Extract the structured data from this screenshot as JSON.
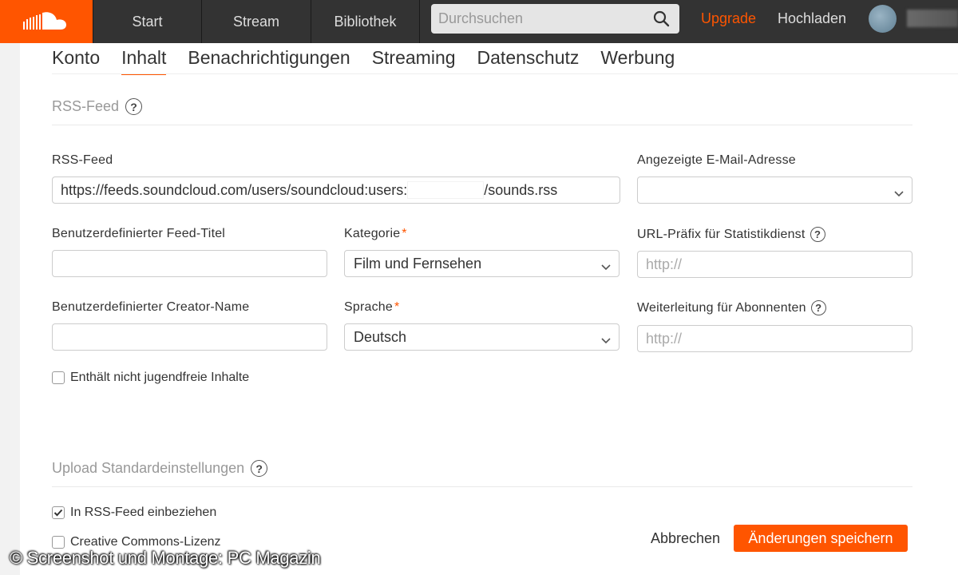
{
  "topbar": {
    "nav": [
      "Start",
      "Stream",
      "Bibliothek"
    ],
    "search_placeholder": "Durchsuchen",
    "upgrade": "Upgrade",
    "upload": "Hochladen",
    "accent": "#ff5500"
  },
  "tabs": [
    "Konto",
    "Inhalt",
    "Benachrichtigungen",
    "Streaming",
    "Datenschutz",
    "Werbung"
  ],
  "active_tab": "Inhalt",
  "rss_section": {
    "title": "RSS-Feed",
    "rss_feed_label": "RSS-Feed",
    "rss_feed_prefix": "https://feeds.soundcloud.com/users/soundcloud:users:",
    "rss_feed_suffix": "/sounds.rss",
    "email_label": "Angezeigte E-Mail-Adresse",
    "feed_title_label": "Benutzerdefinierter Feed-Titel",
    "category_label": "Kategorie",
    "category_value": "Film und Fernsehen",
    "url_prefix_label": "URL-Präfix für Statistikdienst",
    "url_prefix_placeholder": "http://",
    "creator_label": "Benutzerdefinierter Creator-Name",
    "language_label": "Sprache",
    "language_value": "Deutsch",
    "redirect_label": "Weiterleitung für Abonnenten",
    "redirect_placeholder": "http://",
    "explicit_label": "Enthält nicht jugendfreie Inhalte",
    "required_mark": "*"
  },
  "upload_section": {
    "title": "Upload Standardeinstellungen",
    "include_rss_label": "In RSS-Feed einbeziehen",
    "include_rss_checked": true,
    "cc_label": "Creative Commons-Lizenz",
    "cc_checked": false
  },
  "actions": {
    "cancel": "Abbrechen",
    "save": "Änderungen speichern"
  },
  "watermark": "© Screenshot und Montage: PC Magazin"
}
